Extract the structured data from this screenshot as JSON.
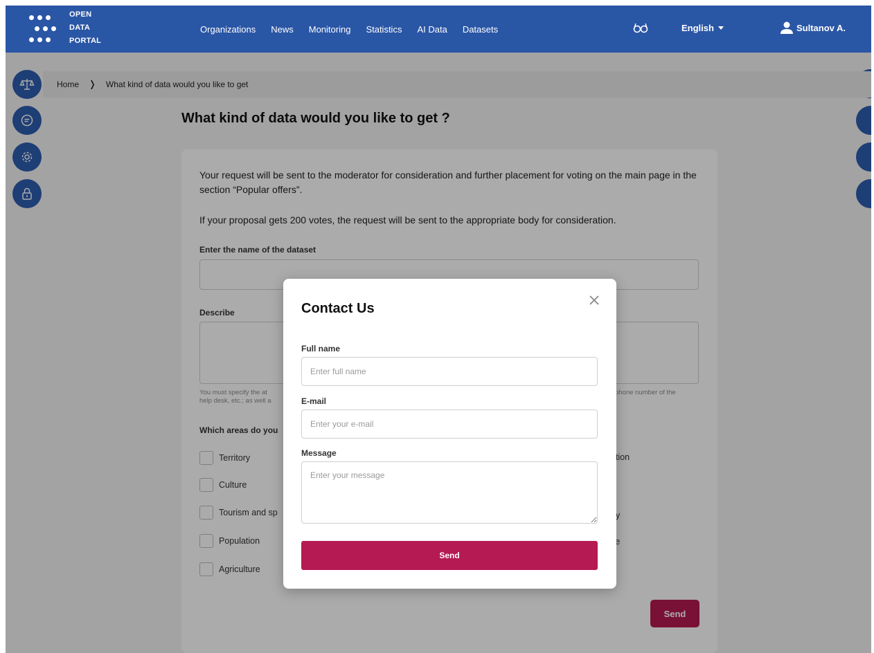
{
  "header": {
    "logo_lines": [
      "OPEN",
      "DATA",
      "PORTAL"
    ],
    "nav": [
      "Organizations",
      "News",
      "Monitoring",
      "Statistics",
      "AI Data",
      "Datasets"
    ],
    "language": "English",
    "user": "Sultanov A."
  },
  "left_rail": [
    "scales-icon",
    "message-icon",
    "gear-icon",
    "lock-icon"
  ],
  "breadcrumb": {
    "home": "Home",
    "current": "What kind of data would you like to get"
  },
  "page": {
    "title": "What kind of data would you like to get ?",
    "intro_1": "Your request will be sent to the moderator for consideration and further placement for voting on the main page in the section “Popular offers”.",
    "intro_2": "If your proposal gets 200 votes, the request will be sent to the appropriate body for consideration.",
    "dataset_label": "Enter the name of the dataset",
    "describe_label": "Describe",
    "hint_left_1": "You must specify the at",
    "hint_left_2": "help desk, etc.; as well a",
    "hint_right": "phone number of the",
    "areas_label": "Which areas do you",
    "areas_left": [
      "Territory",
      "Culture",
      "Tourism and sp",
      "Population",
      "Agriculture"
    ],
    "areas_right": [
      "ation",
      "gy",
      "se"
    ],
    "send_label": "Send"
  },
  "modal": {
    "title": "Contact Us",
    "full_name_label": "Full name",
    "full_name_placeholder": "Enter full name",
    "email_label": "E-mail",
    "email_placeholder": "Enter your e-mail",
    "message_label": "Message",
    "message_placeholder": "Enter your message",
    "send_label": "Send"
  },
  "colors": {
    "header": "#2a56a6",
    "accent": "#b51a52"
  }
}
